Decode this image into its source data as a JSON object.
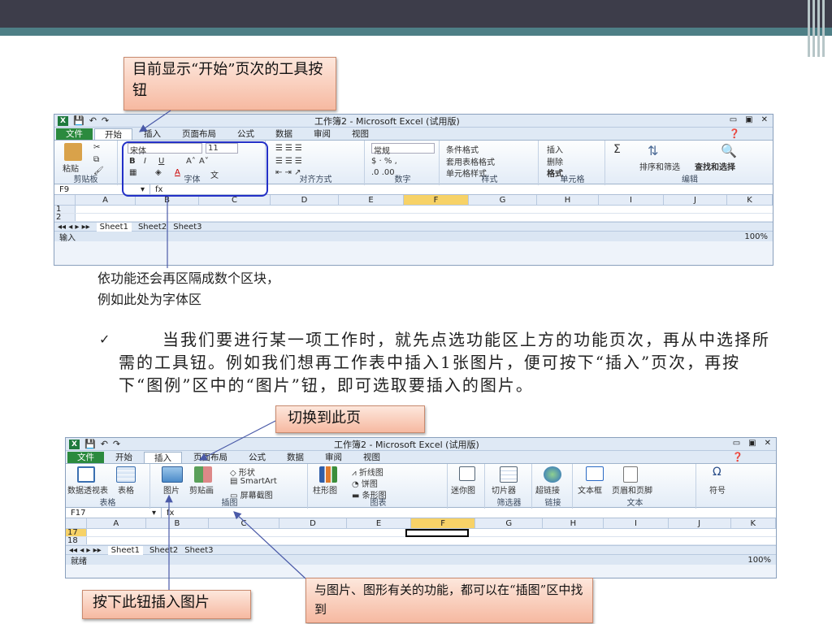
{
  "callouts": {
    "c1": "目前显示“开始”页次的工具按钮",
    "c2": "切换到此页",
    "c3": "按下此钮插入图片",
    "c4": "与图片、图形有关的功能，都可以在“插图”区中找到"
  },
  "caption": {
    "line1": "依功能还会再区隔成数个区块，",
    "line2": "例如此处为字体区"
  },
  "body": {
    "check": "✓",
    "text": "当我们要进行某一项工作时，就先点选功能区上方的功能页次，再从中选择所需的工具钮。例如我们想再工作表中插入1张图片，便可按下“插入”页次，再按下“图例”区中的“图片”钮，即可选取要插入的图片。"
  },
  "excel1": {
    "title": "工作簿2 - Microsoft Excel (试用版)",
    "tabs": [
      "文件",
      "开始",
      "插入",
      "页面布局",
      "公式",
      "数据",
      "审阅",
      "视图"
    ],
    "active_tab": "开始",
    "groups": {
      "clipboard": "剪贴板",
      "paste": "粘贴",
      "font": "字体",
      "font_name": "宋体",
      "font_size": "11",
      "alignment": "对齐方式",
      "number": "数字",
      "number_format": "常规",
      "styles": "样式",
      "cond_format": "条件格式",
      "table_format": "套用表格格式",
      "cell_style": "单元格样式",
      "cells": "单元格",
      "insert": "插入",
      "delete": "删除",
      "format": "格式",
      "editing": "编辑",
      "sort": "排序和筛选",
      "find": "查找和选择"
    },
    "namebox": "F9",
    "fx": "fx",
    "columns": [
      "A",
      "B",
      "C",
      "D",
      "E",
      "F",
      "G",
      "H",
      "I",
      "J",
      "K"
    ],
    "selected_col": "F",
    "rows": [
      "1",
      "2"
    ],
    "sheets": [
      "Sheet1",
      "Sheet2",
      "Sheet3"
    ],
    "status": "输入",
    "zoom": "100%"
  },
  "excel2": {
    "title": "工作簿2 - Microsoft Excel (试用版)",
    "tabs": [
      "文件",
      "开始",
      "插入",
      "页面布局",
      "公式",
      "数据",
      "审阅",
      "视图"
    ],
    "active_tab": "插入",
    "groups": {
      "tables": "表格",
      "pivot": "数据透视表",
      "table": "表格",
      "illustrations": "插图",
      "picture": "图片",
      "clipart": "剪贴画",
      "shapes": "形状",
      "smartart": "SmartArt",
      "screenshot": "屏幕截图",
      "charts": "图表",
      "column": "柱形图",
      "line": "折线图",
      "pie": "饼图",
      "bar": "条形图",
      "sparkline": "迷你图",
      "slicer": "切片器",
      "filter": "筛选器",
      "hyperlink": "超链接",
      "links": "链接",
      "textbox": "文本框",
      "header": "页眉和页脚",
      "text": "文本",
      "symbol": "符号"
    },
    "namebox": "F17",
    "fx": "fx",
    "columns": [
      "A",
      "B",
      "C",
      "D",
      "E",
      "F",
      "G",
      "H",
      "I",
      "J",
      "K"
    ],
    "selected_col": "F",
    "rows": [
      "17",
      "18"
    ],
    "sheets": [
      "Sheet1",
      "Sheet2",
      "Sheet3"
    ],
    "status": "就绪",
    "zoom": "100%"
  },
  "colors": {
    "topbar": "#3d3d4a",
    "teal": "#4e7f86",
    "highlight": "#2330c7",
    "arrow": "#4a5aa8"
  }
}
